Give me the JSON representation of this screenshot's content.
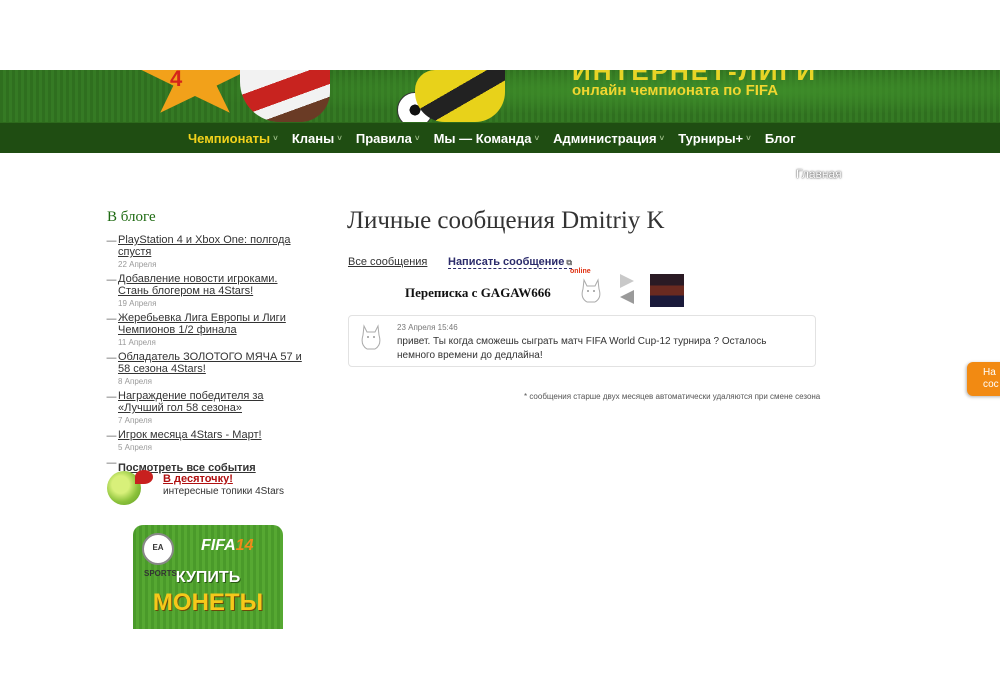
{
  "banner": {
    "logo_number": "4",
    "title": "ИНТЕРНЕТ-ЛИГИ",
    "subtitle": "онлайн чемпионата по FIFA"
  },
  "nav": {
    "items": [
      {
        "label": "Чемпионаты",
        "has_dropdown": true,
        "active": true
      },
      {
        "label": "Кланы",
        "has_dropdown": true
      },
      {
        "label": "Правила",
        "has_dropdown": true
      },
      {
        "label": "Мы — Команда",
        "has_dropdown": true
      },
      {
        "label": "Администрация",
        "has_dropdown": true
      },
      {
        "label": "Турниры+",
        "has_dropdown": true
      },
      {
        "label": "Блог",
        "has_dropdown": false
      }
    ],
    "caret": "˅"
  },
  "breadcrumb": "Главная",
  "sidebar": {
    "title": "В блоге",
    "items": [
      {
        "text": "PlayStation 4 и Xbox One: полгода спустя",
        "date": "22 Апреля"
      },
      {
        "text": "Добавление новости игроками. Стань блогером на 4Stars!",
        "date": "19 Апреля"
      },
      {
        "text": "Жеребьевка Лига Европы и Лиги Чемпионов 1/2 финала",
        "date": "11 Апреля"
      },
      {
        "text": "Обладатель ЗОЛОТОГО МЯЧА 57 и 58 сезона 4Stars!",
        "date": "8 Апреля"
      },
      {
        "text": "Награждение победителя за «Лучший гол 58 сезона»",
        "date": "7 Апреля"
      },
      {
        "text": "Игрок месяца 4Stars - Март!",
        "date": "5 Апреля"
      }
    ],
    "see_all": "Посмотреть все события",
    "top10_link": "В десяточку!",
    "top10_sub": "интересные топики 4Stars",
    "ad": {
      "brand": "EA SPORTS",
      "game_prefix": "FIFA",
      "game_num": "14",
      "line1": "КУПИТЬ",
      "line2": "МОНЕТЫ"
    }
  },
  "main": {
    "title": "Личные сообщения Dmitriy K",
    "tabs": {
      "all": "Все сообщения",
      "write": "Написать сообщение"
    },
    "conversation": {
      "title": "Переписка с GAGAW666",
      "status": "online"
    },
    "messages": [
      {
        "time": "23 Апреля 15:46",
        "text": "привет. Ты когда сможешь сыграть матч FIFA World Cup-12 турнира ? Осталось немного времени до дедлайна!"
      }
    ],
    "footnote": "* сообщения старше двух месяцев автоматически удаляются при смене сезона"
  },
  "side_tab": {
    "line1": "На",
    "line2": "сос"
  },
  "colors": {
    "nav_bg": "#1f4d12",
    "nav_active": "#f2d21c",
    "sidebar_title": "#1f6b13",
    "accent_orange": "#f28a12"
  }
}
